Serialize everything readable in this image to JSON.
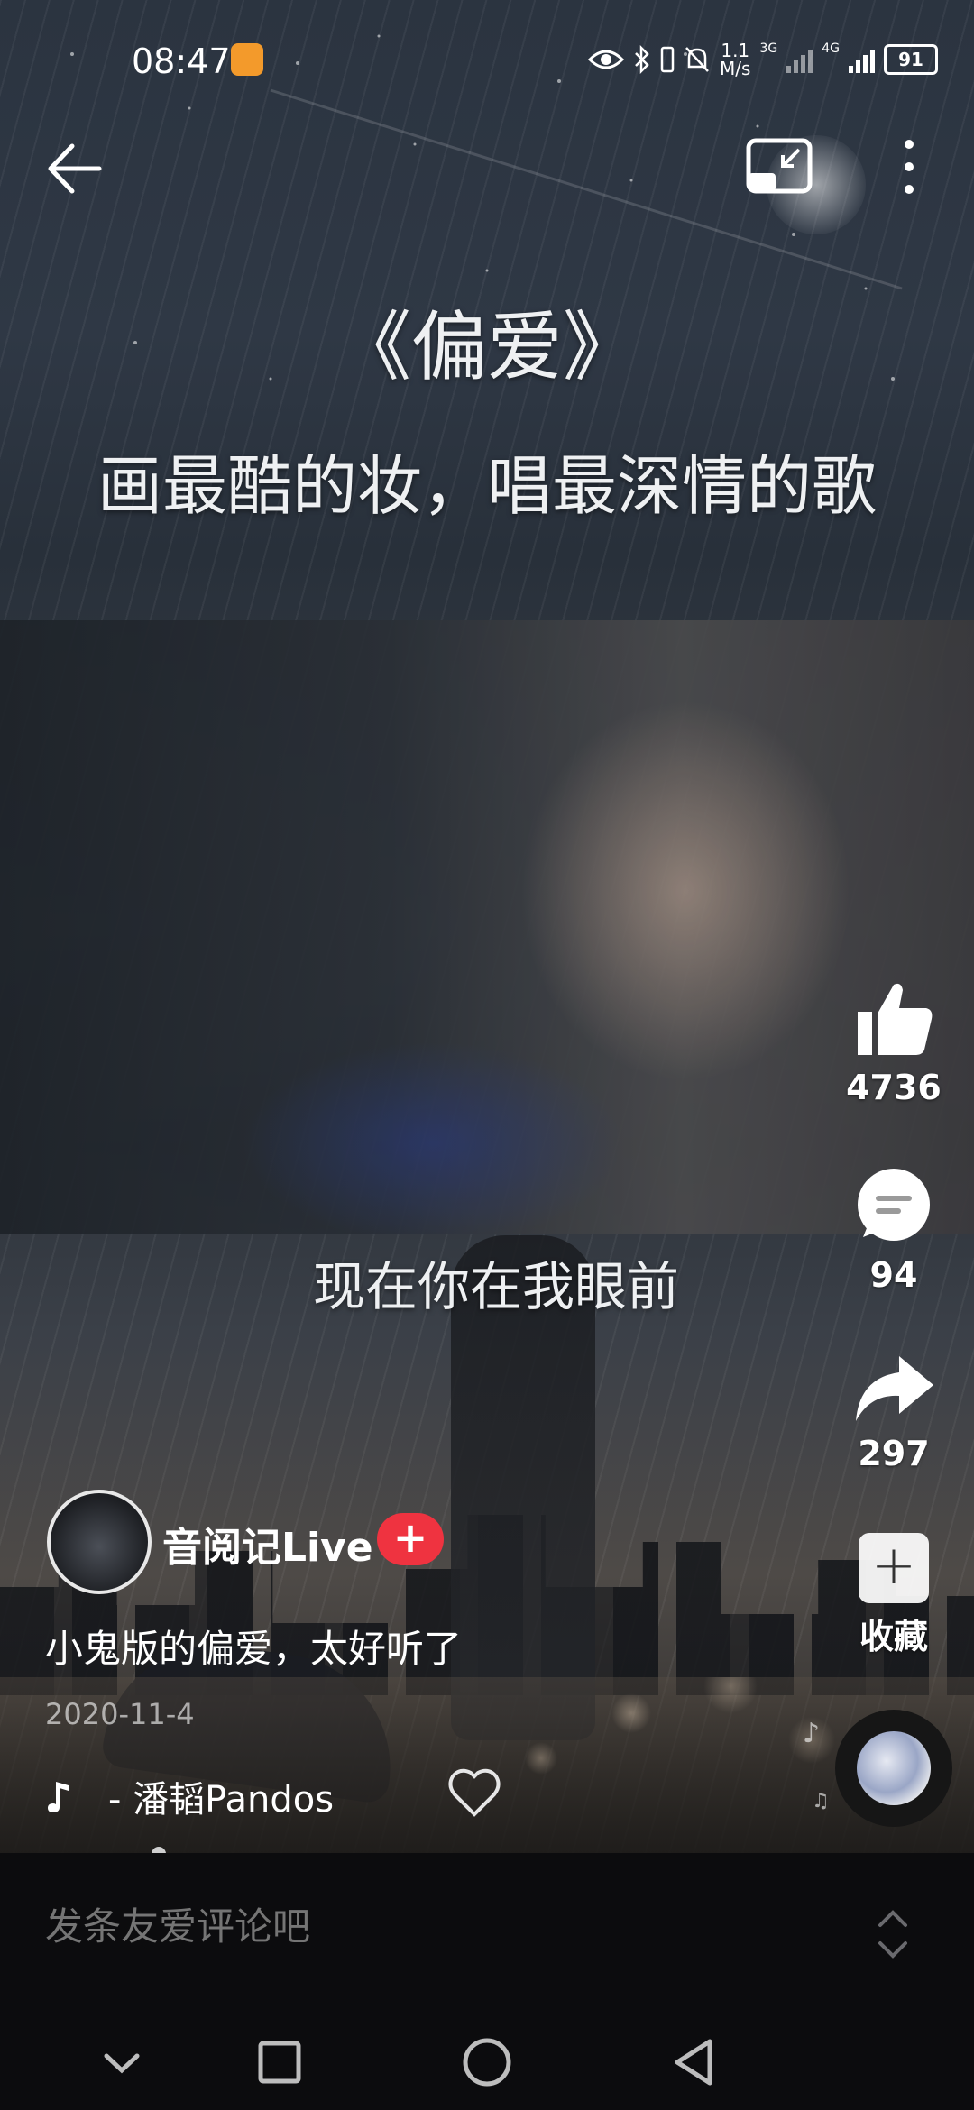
{
  "status_bar": {
    "time": "08:47",
    "net_speed_value": "1.1",
    "net_speed_unit": "M/s",
    "sim1_type": "3G",
    "sim2_type": "4G",
    "battery": "91"
  },
  "video": {
    "title_text": "《偏爱》",
    "subtitle_text": "画最酷的妆，唱最深情的歌",
    "lyric": "现在你在我眼前"
  },
  "actions": {
    "like_count": "4736",
    "comment_count": "94",
    "share_count": "297",
    "favorite_label": "收藏"
  },
  "author": {
    "name": "音阅记Live",
    "follow_label": "+"
  },
  "post": {
    "description": "小鬼版的偏爱，太好听了",
    "date": "2020-11-4",
    "music": "- 潘韬Pandos"
  },
  "comment": {
    "placeholder": "发条友爱评论吧"
  },
  "colors": {
    "follow_red": "#ef3340",
    "app_badge": "#f39a2b"
  }
}
